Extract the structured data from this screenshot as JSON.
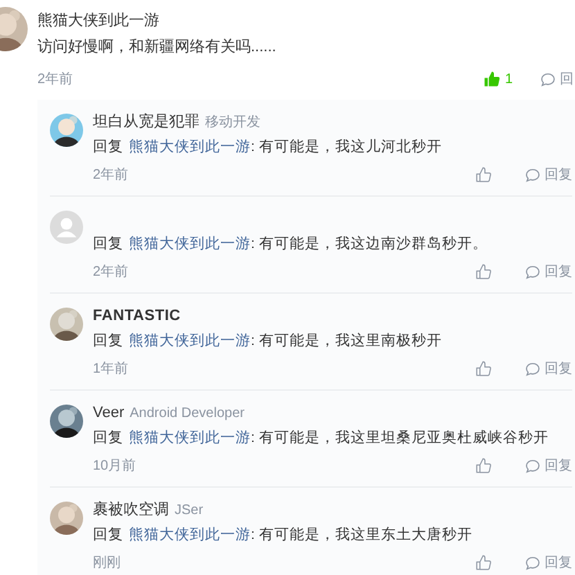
{
  "comment": {
    "author": "熊猫大侠到此一游",
    "text": "访问好慢啊，和新疆网络有关吗......",
    "time": "2年前",
    "liked": true,
    "like_count": "1",
    "reply_button": "回"
  },
  "replies": [
    {
      "author": "坦白从宽是犯罪",
      "tag": "移动开发",
      "prefix": "回复",
      "mention": "熊猫大侠到此一游",
      "text": ": 有可能是，我这儿河北秒开",
      "time": "2年前",
      "liked": false,
      "reply_button": "回复"
    },
    {
      "avatar": {
        "kind": "placeholder"
      },
      "prefix": "回复",
      "mention": "熊猫大侠到此一游",
      "text": ": 有可能是，我这边南沙群岛秒开。",
      "time": "2年前",
      "liked": false,
      "reply_button": "回复"
    },
    {
      "author": "FANTASTIC",
      "prefix": "回复",
      "mention": "熊猫大侠到此一游",
      "text": ": 有可能是，我这里南极秒开",
      "time": "1年前",
      "liked": false,
      "reply_button": "回复"
    },
    {
      "author": "Veer",
      "tag": "Android Developer",
      "prefix": "回复",
      "mention": "熊猫大侠到此一游",
      "text": ": 有可能是，我这里坦桑尼亚奥杜威峡谷秒开",
      "time": "10月前",
      "liked": false,
      "reply_button": "回复"
    },
    {
      "author": "裹被吹空调",
      "tag": "JSer",
      "prefix": "回复",
      "mention": "熊猫大侠到此一游",
      "text": ": 有可能是，我这里东土大唐秒开",
      "time": "刚刚",
      "liked": false,
      "reply_button": "回复"
    }
  ]
}
